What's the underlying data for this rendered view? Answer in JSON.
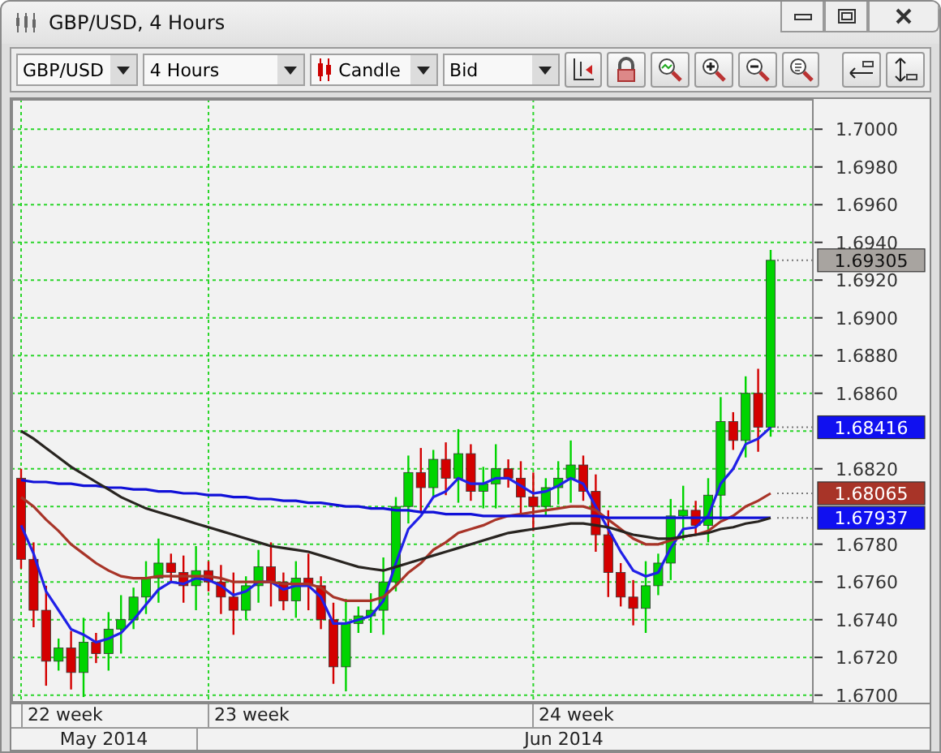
{
  "window": {
    "title": "GBP/USD, 4 Hours"
  },
  "toolbar": {
    "symbol": "GBP/USD",
    "period": "4 Hours",
    "chart_type": "Candle",
    "price": "Bid"
  },
  "chart": {
    "chart_data": {
      "type": "candlestick",
      "grid": true,
      "ylim": [
        1.6696,
        1.7016
      ],
      "yticks": [
        {
          "value": 1.67,
          "label": "1.6700"
        },
        {
          "value": 1.672,
          "label": "1.6720"
        },
        {
          "value": 1.674,
          "label": "1.6740"
        },
        {
          "value": 1.676,
          "label": "1.6760"
        },
        {
          "value": 1.678,
          "label": "1.6780"
        },
        {
          "value": 1.682,
          "label": "1.6820"
        },
        {
          "value": 1.686,
          "label": "1.6860"
        },
        {
          "value": 1.688,
          "label": "1.6880"
        },
        {
          "value": 1.69,
          "label": "1.6900"
        },
        {
          "value": 1.692,
          "label": "1.6920"
        },
        {
          "value": 1.694,
          "label": "1.6940"
        },
        {
          "value": 1.696,
          "label": "1.6960"
        },
        {
          "value": 1.698,
          "label": "1.6980"
        },
        {
          "value": 1.7,
          "label": "1.7000"
        }
      ],
      "ohlc": [
        [
          1.6815,
          1.682,
          1.6767,
          1.6772
        ],
        [
          1.6772,
          1.6781,
          1.6736,
          1.6745
        ],
        [
          1.6745,
          1.6758,
          1.6705,
          1.6718
        ],
        [
          1.6718,
          1.673,
          1.6713,
          1.6725
        ],
        [
          1.6725,
          1.6734,
          1.6703,
          1.6712
        ],
        [
          1.6712,
          1.6741,
          1.6699,
          1.6728
        ],
        [
          1.6728,
          1.6733,
          1.6717,
          1.6722
        ],
        [
          1.6722,
          1.6744,
          1.6713,
          1.6735
        ],
        [
          1.6735,
          1.6753,
          1.6722,
          1.674
        ],
        [
          1.674,
          1.6757,
          1.6735,
          1.6752
        ],
        [
          1.6752,
          1.6771,
          1.6743,
          1.6762
        ],
        [
          1.6762,
          1.6783,
          1.6749,
          1.677
        ],
        [
          1.677,
          1.6775,
          1.676,
          1.6765
        ],
        [
          1.6765,
          1.6774,
          1.6749,
          1.6758
        ],
        [
          1.6758,
          1.6779,
          1.6745,
          1.6766
        ],
        [
          1.6766,
          1.6771,
          1.6755,
          1.676
        ],
        [
          1.676,
          1.6769,
          1.6743,
          1.6752
        ],
        [
          1.6752,
          1.6765,
          1.6732,
          1.6745
        ],
        [
          1.6745,
          1.6763,
          1.674,
          1.6758
        ],
        [
          1.6758,
          1.6777,
          1.6749,
          1.6768
        ],
        [
          1.6768,
          1.6781,
          1.6747,
          1.676
        ],
        [
          1.676,
          1.6765,
          1.6745,
          1.675
        ],
        [
          1.675,
          1.6771,
          1.6741,
          1.6762
        ],
        [
          1.6762,
          1.6775,
          1.6745,
          1.6758
        ],
        [
          1.6758,
          1.6763,
          1.6735,
          1.674
        ],
        [
          1.674,
          1.6749,
          1.6706,
          1.6715
        ],
        [
          1.6715,
          1.6751,
          1.6702,
          1.6738
        ],
        [
          1.6738,
          1.6747,
          1.6733,
          1.6742
        ],
        [
          1.6742,
          1.6754,
          1.6733,
          1.6745
        ],
        [
          1.6745,
          1.6773,
          1.6732,
          1.676
        ],
        [
          1.676,
          1.6805,
          1.6755,
          1.68
        ],
        [
          1.68,
          1.6827,
          1.6791,
          1.6818
        ],
        [
          1.6818,
          1.6831,
          1.6797,
          1.681
        ],
        [
          1.681,
          1.683,
          1.6805,
          1.6825
        ],
        [
          1.6825,
          1.6834,
          1.6806,
          1.6815
        ],
        [
          1.6815,
          1.6841,
          1.6802,
          1.6828
        ],
        [
          1.6828,
          1.6833,
          1.6803,
          1.6808
        ],
        [
          1.6808,
          1.6821,
          1.6799,
          1.6812
        ],
        [
          1.6812,
          1.6833,
          1.6799,
          1.682
        ],
        [
          1.682,
          1.6825,
          1.681,
          1.6815
        ],
        [
          1.6815,
          1.6824,
          1.6796,
          1.6805
        ],
        [
          1.6805,
          1.6818,
          1.6787,
          1.68
        ],
        [
          1.68,
          1.6815,
          1.6795,
          1.681
        ],
        [
          1.681,
          1.6824,
          1.6801,
          1.6815
        ],
        [
          1.6815,
          1.6835,
          1.6802,
          1.6822
        ],
        [
          1.6822,
          1.6827,
          1.6803,
          1.6808
        ],
        [
          1.6808,
          1.6817,
          1.6776,
          1.6785
        ],
        [
          1.6785,
          1.6798,
          1.6752,
          1.6765
        ],
        [
          1.6765,
          1.677,
          1.6747,
          1.6752
        ],
        [
          1.6752,
          1.6761,
          1.6737,
          1.6746
        ],
        [
          1.6746,
          1.6771,
          1.6733,
          1.6758
        ],
        [
          1.6758,
          1.6775,
          1.6753,
          1.677
        ],
        [
          1.677,
          1.6804,
          1.6761,
          1.6795
        ],
        [
          1.6795,
          1.6811,
          1.6782,
          1.6798
        ],
        [
          1.6798,
          1.6803,
          1.6785,
          1.679
        ],
        [
          1.679,
          1.6815,
          1.6781,
          1.6806
        ],
        [
          1.6806,
          1.6858,
          1.6793,
          1.6845
        ],
        [
          1.6845,
          1.685,
          1.683,
          1.6835
        ],
        [
          1.6835,
          1.6869,
          1.6826,
          1.686
        ],
        [
          1.686,
          1.6873,
          1.6829,
          1.6842
        ],
        [
          1.6842,
          1.6936,
          1.6837,
          1.69305
        ]
      ]
    },
    "indicators": {
      "chart_data": {
        "type": "line",
        "ylim": [
          1.6696,
          1.7016
        ],
        "series": [
          {
            "color": "#2020e8",
            "values": [
              1.679,
              1.6775,
              1.6755,
              1.6745,
              1.6735,
              1.6732,
              1.6728,
              1.673,
              1.6733,
              1.674,
              1.6748,
              1.6756,
              1.676,
              1.6759,
              1.6762,
              1.6761,
              1.6758,
              1.6753,
              1.6755,
              1.676,
              1.676,
              1.6756,
              1.6758,
              1.6758,
              1.6752,
              1.6738,
              1.6738,
              1.674,
              1.6742,
              1.675,
              1.677,
              1.6788,
              1.6795,
              1.6805,
              1.6808,
              1.6815,
              1.6812,
              1.6812,
              1.6815,
              1.6815,
              1.6811,
              1.6807,
              1.6808,
              1.6811,
              1.6815,
              1.6812,
              1.68,
              1.6788,
              1.6776,
              1.6766,
              1.6763,
              1.6765,
              1.6778,
              1.6788,
              1.6789,
              1.6795,
              1.6812,
              1.682,
              1.6833,
              1.6836,
              1.6842
            ]
          },
          {
            "color": "#a83428",
            "values": [
              1.6805,
              1.68,
              1.6793,
              1.6787,
              1.678,
              1.6775,
              1.677,
              1.6766,
              1.6763,
              1.6762,
              1.6762,
              1.6763,
              1.6763,
              1.6763,
              1.6763,
              1.6763,
              1.6762,
              1.676,
              1.676,
              1.676,
              1.676,
              1.6759,
              1.6759,
              1.6759,
              1.6757,
              1.6752,
              1.675,
              1.675,
              1.675,
              1.6752,
              1.6758,
              1.6765,
              1.677,
              1.6777,
              1.6781,
              1.6786,
              1.6788,
              1.679,
              1.6793,
              1.6795,
              1.6796,
              1.6797,
              1.6798,
              1.6799,
              1.68,
              1.68,
              1.6798,
              1.6793,
              1.6788,
              1.6783,
              1.678,
              1.678,
              1.6782,
              1.6784,
              1.6785,
              1.6787,
              1.6792,
              1.6795,
              1.68,
              1.6803,
              1.6807
            ]
          },
          {
            "color": "#1010d8",
            "values": [
              1.6814,
              1.6813,
              1.6813,
              1.6812,
              1.6812,
              1.6811,
              1.6811,
              1.681,
              1.681,
              1.6809,
              1.6809,
              1.6808,
              1.6808,
              1.6807,
              1.6807,
              1.6806,
              1.6806,
              1.6805,
              1.6805,
              1.6804,
              1.6804,
              1.6803,
              1.6803,
              1.6802,
              1.6802,
              1.6801,
              1.68,
              1.68,
              1.6799,
              1.6799,
              1.6798,
              1.6798,
              1.6797,
              1.6797,
              1.6796,
              1.6796,
              1.6796,
              1.6795,
              1.6795,
              1.6795,
              1.6795,
              1.6795,
              1.6795,
              1.6795,
              1.6795,
              1.6795,
              1.6795,
              1.6794,
              1.6794,
              1.6794,
              1.6794,
              1.6794,
              1.6794,
              1.6794,
              1.6794,
              1.6794,
              1.6794,
              1.6794,
              1.6794,
              1.6794,
              1.6794
            ]
          },
          {
            "color": "#282420",
            "values": [
              1.684,
              1.6836,
              1.6831,
              1.6826,
              1.6821,
              1.6817,
              1.6813,
              1.6809,
              1.6805,
              1.6802,
              1.6799,
              1.6797,
              1.6795,
              1.6793,
              1.6791,
              1.6789,
              1.6787,
              1.6785,
              1.6783,
              1.6781,
              1.6779,
              1.6778,
              1.6777,
              1.6776,
              1.6774,
              1.6772,
              1.677,
              1.6768,
              1.6767,
              1.6766,
              1.6768,
              1.677,
              1.6772,
              1.6774,
              1.6776,
              1.6778,
              1.678,
              1.6782,
              1.6784,
              1.6786,
              1.6787,
              1.6788,
              1.6789,
              1.679,
              1.6791,
              1.6791,
              1.679,
              1.6789,
              1.6787,
              1.6785,
              1.6784,
              1.6783,
              1.6783,
              1.6784,
              1.6785,
              1.6786,
              1.6788,
              1.6789,
              1.6791,
              1.6792,
              1.6794
            ]
          }
        ]
      }
    },
    "price_markers": [
      {
        "label": "1.69305",
        "color": "#a8a4a0"
      },
      {
        "label": "1.68416",
        "color": "#1010f0"
      },
      {
        "label": "1.68065",
        "color": "#a83428"
      },
      {
        "label": "1.67937",
        "color": "#1010f0"
      }
    ],
    "week_labels": [
      "22 week",
      "23 week",
      "24 week"
    ],
    "month_labels": [
      "May 2014",
      "Jun 2014"
    ]
  }
}
